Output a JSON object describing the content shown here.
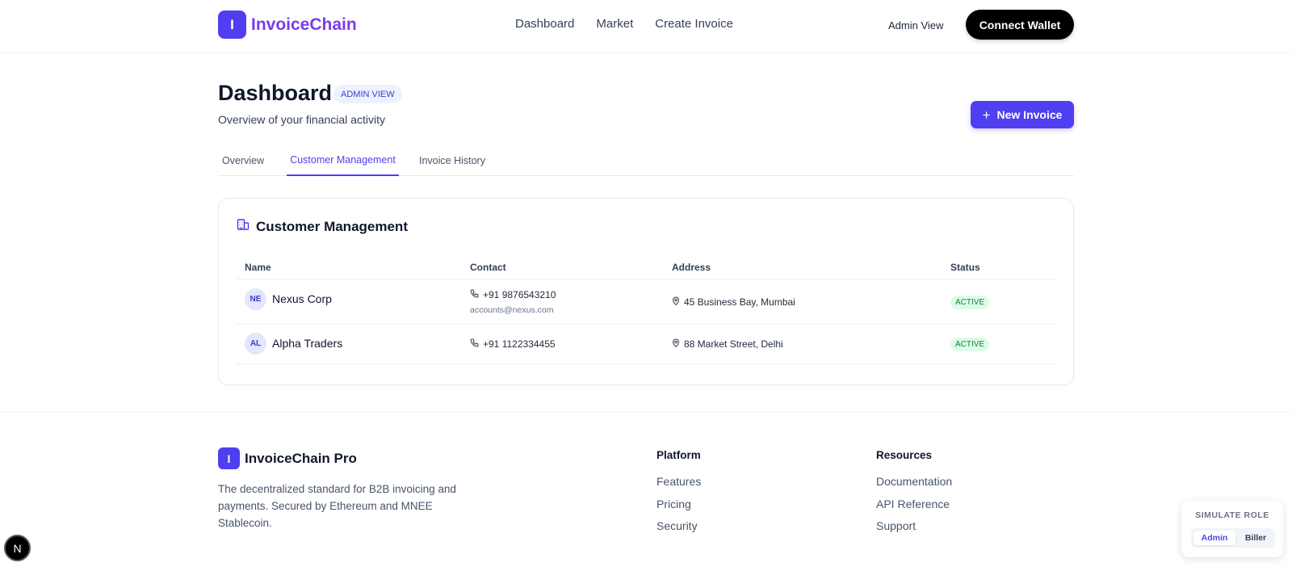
{
  "header": {
    "logo_letter": "I",
    "logo_text": "InvoiceChain",
    "nav": [
      "Dashboard",
      "Market",
      "Create Invoice"
    ],
    "admin_view_link": "Admin View",
    "connect_wallet": "Connect Wallet"
  },
  "page": {
    "title": "Dashboard",
    "badge": "ADMIN VIEW",
    "subtitle": "Overview of your financial activity",
    "new_invoice": "New Invoice"
  },
  "tabs": [
    {
      "label": "Overview",
      "active": false
    },
    {
      "label": "Customer Management",
      "active": true
    },
    {
      "label": "Invoice History",
      "active": false
    }
  ],
  "customers": {
    "title": "Customer Management",
    "columns": [
      "Name",
      "Contact",
      "Address",
      "Status"
    ],
    "rows": [
      {
        "initials": "NE",
        "name": "Nexus Corp",
        "phone": "+91 9876543210",
        "email": "accounts@nexus.com",
        "address": "45 Business Bay, Mumbai",
        "status": "ACTIVE"
      },
      {
        "initials": "AL",
        "name": "Alpha Traders",
        "phone": "+91 1122334455",
        "email": "",
        "address": "88 Market Street, Delhi",
        "status": "ACTIVE"
      }
    ]
  },
  "footer": {
    "logo_letter": "I",
    "brand": "InvoiceChain Pro",
    "description": "The decentralized standard for B2B invoicing and payments. Secured by Ethereum and MNEE Stablecoin.",
    "platform": {
      "title": "Platform",
      "links": [
        "Features",
        "Pricing",
        "Security"
      ]
    },
    "resources": {
      "title": "Resources",
      "links": [
        "Documentation",
        "API Reference",
        "Support"
      ]
    }
  },
  "role_switcher": {
    "label": "SIMULATE ROLE",
    "options": [
      "Admin",
      "Biller"
    ],
    "selected": "Admin"
  },
  "dev_badge": "N",
  "colors": {
    "primary": "#4f3ff0",
    "brand_text": "#7c3aed",
    "status_active_bg": "#dcfce7",
    "status_active_text": "#15803d"
  },
  "icons": [
    "building-icon",
    "phone-icon",
    "map-pin-icon",
    "plus-icon"
  ]
}
